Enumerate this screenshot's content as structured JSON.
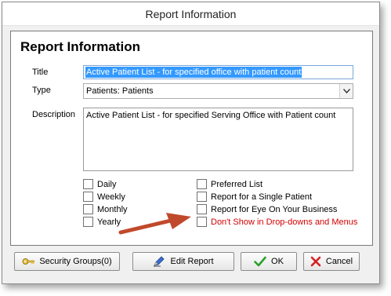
{
  "window": {
    "title": "Report Information"
  },
  "form": {
    "heading": "Report Information",
    "title_label": "Title",
    "title_value": "Active Patient List - for specified office with patient count",
    "type_label": "Type",
    "type_value": "Patients: Patients",
    "description_label": "Description",
    "description_value": "Active Patient List - for specified Serving Office with Patient count"
  },
  "checkboxes_left": [
    {
      "label": "Daily",
      "checked": false
    },
    {
      "label": "Weekly",
      "checked": false
    },
    {
      "label": "Monthly",
      "checked": false
    },
    {
      "label": "Yearly",
      "checked": false
    }
  ],
  "checkboxes_right": [
    {
      "label": "Preferred List",
      "checked": false
    },
    {
      "label": "Report for a Single Patient",
      "checked": false
    },
    {
      "label": "Report for Eye On Your Business",
      "checked": false
    },
    {
      "label": "Don't Show in Drop-downs and Menus",
      "checked": false
    }
  ],
  "buttons": {
    "security_groups": "Security Groups(0)",
    "edit_report": "Edit Report",
    "ok": "OK",
    "cancel": "Cancel"
  },
  "icons": {
    "security": "key-icon",
    "edit": "pen-icon",
    "ok": "checkmark-icon",
    "cancel": "x-icon",
    "dropdown": "chevron-down-icon",
    "annotation": "arrow-icon"
  },
  "colors": {
    "accent_selection": "#3399ff",
    "warning_text": "#d40000",
    "annotation_arrow": "#c0492b",
    "ok_green": "#2ca02c",
    "cancel_red": "#d62020"
  }
}
